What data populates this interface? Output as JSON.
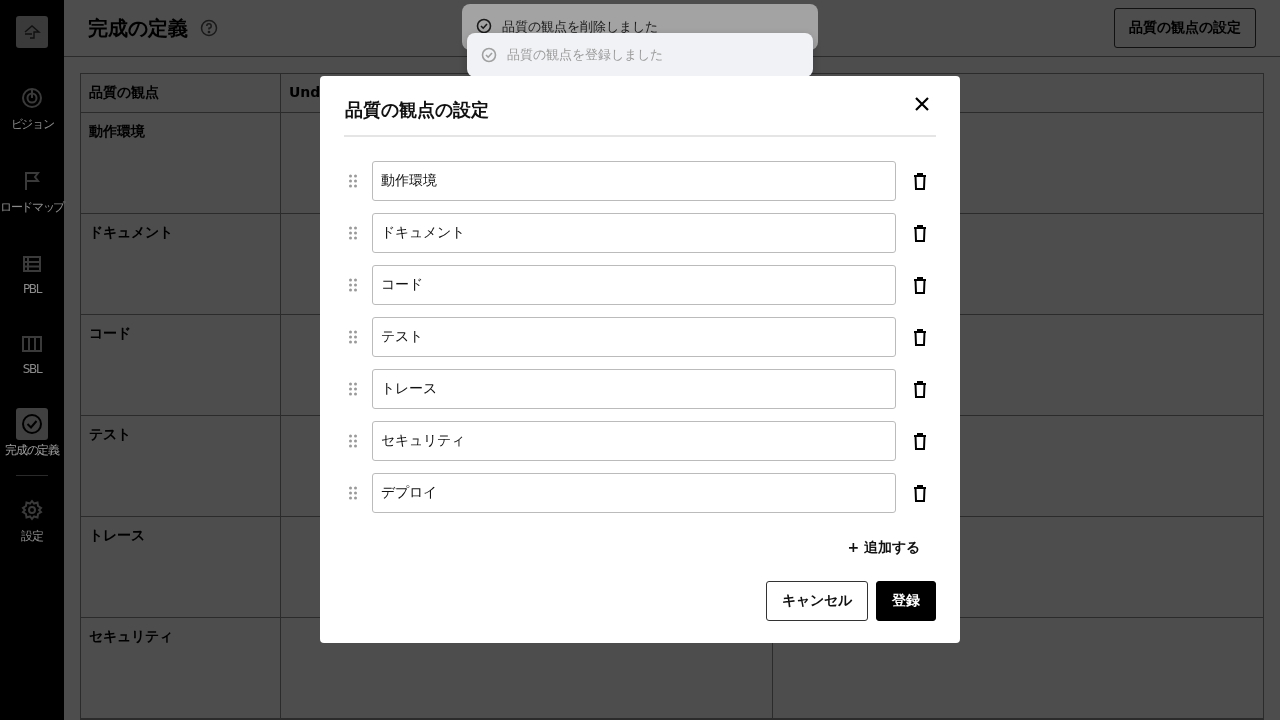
{
  "sidebar": {
    "items": [
      {
        "label": "ビジョン",
        "selected": false
      },
      {
        "label": "ロードマップ",
        "selected": false
      },
      {
        "label": "PBL",
        "selected": false
      },
      {
        "label": "SBL",
        "selected": false
      },
      {
        "label": "完成の定義",
        "selected": true
      },
      {
        "label": "設定",
        "selected": false
      }
    ]
  },
  "page": {
    "title": "完成の定義",
    "settings_button": "品質の観点の設定"
  },
  "table": {
    "columns": [
      "品質の観点",
      "Und"
    ],
    "rows": [
      "動作環境",
      "ドキュメント",
      "コード",
      "テスト",
      "トレース",
      "セキュリティ"
    ]
  },
  "toasts": [
    {
      "message": "品質の観点を削除しました",
      "faded": false
    },
    {
      "message": "品質の観点を登録しました",
      "faded": true
    }
  ],
  "dialog": {
    "title": "品質の観点の設定",
    "items": [
      "動作環境",
      "ドキュメント",
      "コード",
      "テスト",
      "トレース",
      "セキュリティ",
      "デプロイ"
    ],
    "add_link": "+ 追加する",
    "cancel_button": "キャンセル",
    "submit_button": "登録"
  }
}
